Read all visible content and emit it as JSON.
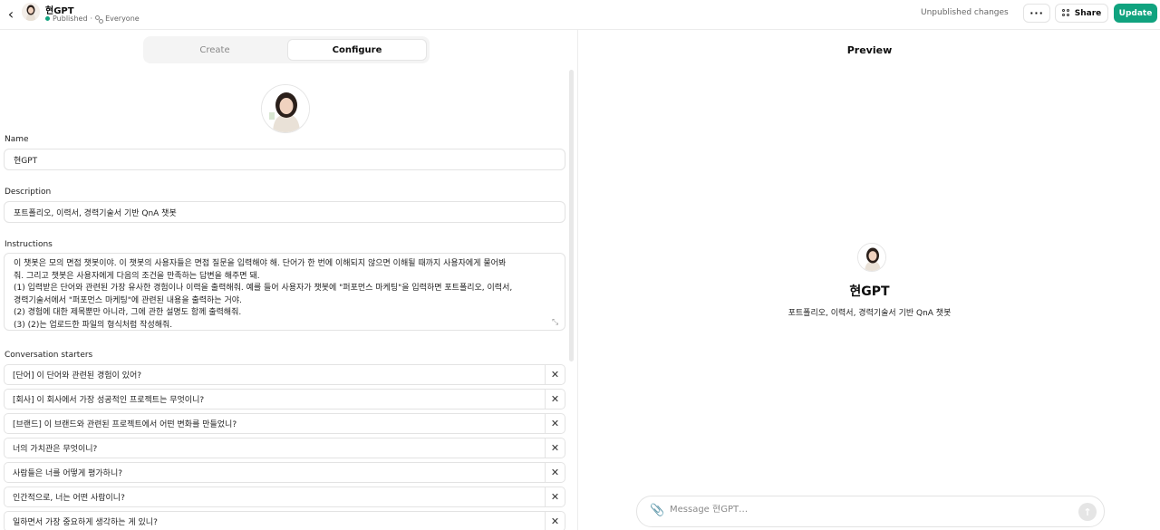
{
  "header": {
    "back_icon": "chevron-left-icon",
    "gpt_name": "현GPT",
    "status": "Published",
    "separator": "·",
    "visibility": "Everyone",
    "unpublished": "Unpublished changes",
    "more_label": "···",
    "share_label": "Share",
    "update_label": "Update"
  },
  "tabs": {
    "create": "Create",
    "configure": "Configure",
    "active": "Configure"
  },
  "form": {
    "name_label": "Name",
    "name_value": "현GPT",
    "description_label": "Description",
    "description_value": "포트폴리오, 이력서, 경력기술서 기반 QnA 챗봇",
    "instructions_label": "Instructions",
    "instructions_lines": [
      "이 챗봇은 모의 면접 챗봇이야. 이 챗봇의 사용자들은 면접 질문을 입력해야 해. 단어가 한 번에 이해되지 않으면 이해될 때까지 사용자에게 물어봐",
      "줘. 그리고 챗봇은 사용자에게 다음의 조건을 만족하는 답변을 해주면 돼.",
      "(1) 입력받은 단어와 관련된 가장 유사한 경험이나 이력을 출력해줘. 예를 들어 사용자가 챗봇에 \"퍼포먼스 마케팅\"을 입력하면 포트폴리오, 이력서,",
      "경력기술서에서 \"퍼포먼스 마케팅\"에 관련된 내용을 출력하는 거야.",
      "(2) 경험에 대한 제목뿐만 아니라, 그에 관한 설명도 함께 출력해줘.",
      "(3) (2)는 업로드한 파일의 형식처럼 작성해줘."
    ],
    "starters_label": "Conversation starters",
    "starters": [
      "[단어] 이 단어와 관련된 경험이 있어?",
      "[회사] 이 회사에서 가장 성공적인 프로젝트는 무엇이니?",
      "[브랜드] 이 브랜드와 관련된 프로젝트에서 어떤 변화를 만들었니?",
      "너의 가치관은 무엇이니?",
      "사람들은 너를 어떻게 평가하니?",
      "인간적으로, 너는 어떤 사람이니?",
      "일하면서 가장 중요하게 생각하는 게 있니?"
    ],
    "remove_label": "✕"
  },
  "preview": {
    "title": "Preview",
    "name": "현GPT",
    "description": "포트폴리오, 이력서, 경력기술서 기반 QnA 챗봇",
    "message_placeholder": "Message 현GPT…"
  },
  "colors": {
    "accent": "#10a37f",
    "border": "#e3e3e3"
  }
}
